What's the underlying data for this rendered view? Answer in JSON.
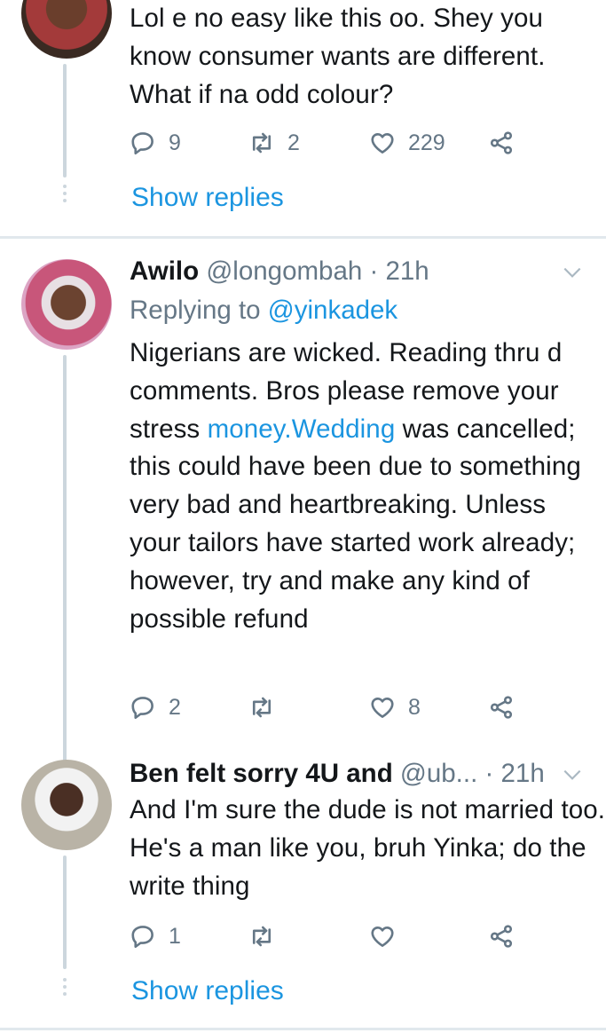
{
  "tweets": [
    {
      "text": "Lol e no easy like this  oo. Shey you know consumer wants are different. What if na odd colour?",
      "reply_count": "9",
      "retweet_count": "2",
      "like_count": "229",
      "show_replies": "Show replies"
    },
    {
      "name": "Awilo",
      "handle": "@longombah",
      "time": "· 21h",
      "replying_prefix": "Replying to",
      "replying_handle": "@yinkadek",
      "text_part1": "Nigerians are wicked. Reading thru d comments. Bros please remove your stress ",
      "text_link": "money.Wedding",
      "text_part2": " was cancelled; this could have been due to something very bad and heartbreaking. Unless your tailors have started work already; however, try and make any kind of possible refund",
      "reply_count": "2",
      "retweet_count": "",
      "like_count": "8"
    },
    {
      "name": "Ben felt sorry 4U and",
      "handle": "@ub...",
      "time": "· 21h",
      "text": "And I'm sure the dude is not married too. He's a man like you, bruh Yinka; do the write thing",
      "reply_count": "1",
      "retweet_count": "",
      "like_count": "",
      "show_replies": "Show replies"
    }
  ],
  "icons": {
    "reply": "reply-icon",
    "retweet": "retweet-icon",
    "like": "heart-icon",
    "share": "share-icon",
    "menu": "chevron-down-icon"
  },
  "colors": {
    "link": "#1b95e0",
    "muted": "#657786",
    "thread_line": "#ccd6dd",
    "divider": "#e1e8ed"
  }
}
